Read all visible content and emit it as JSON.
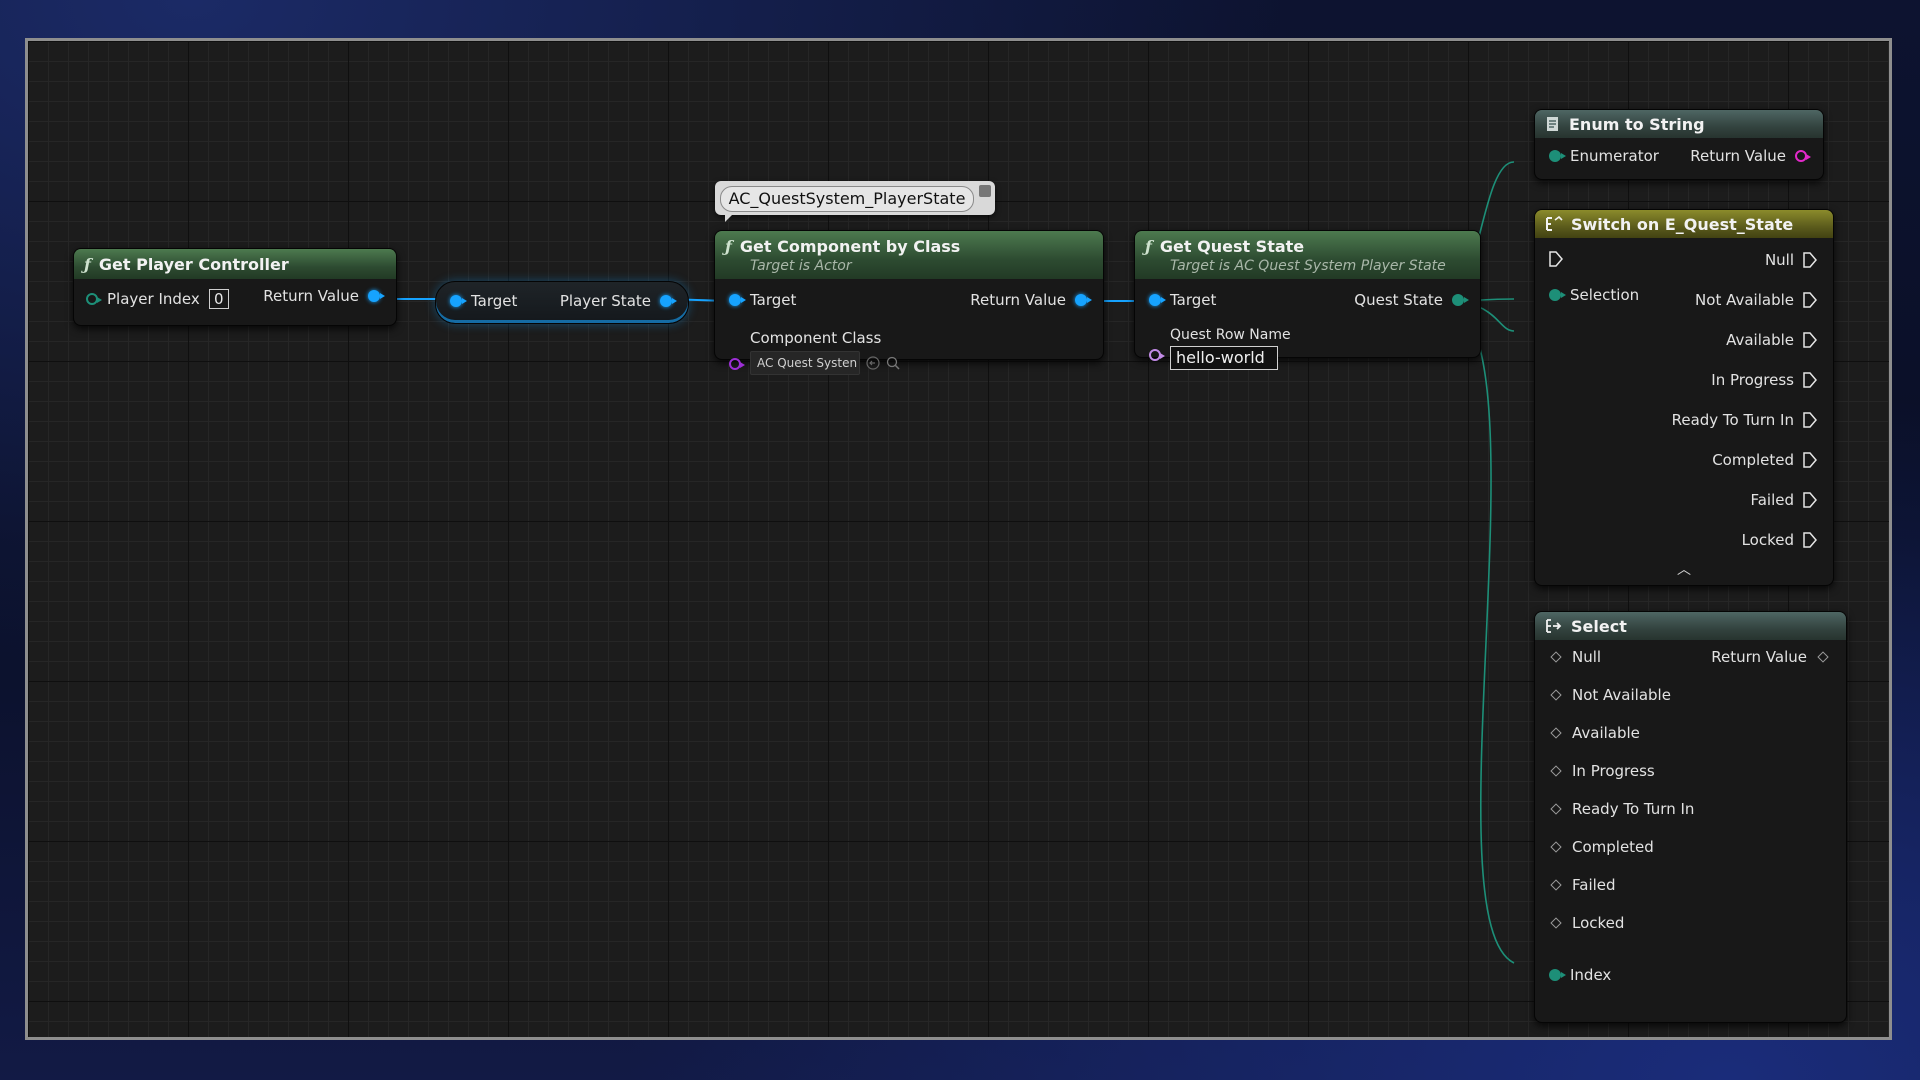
{
  "comment": {
    "text": "AC_QuestSystem_PlayerState"
  },
  "nodes": {
    "get_player_controller": {
      "title": "Get Player Controller",
      "player_index_label": "Player Index",
      "player_index_value": "0",
      "return_value_label": "Return Value"
    },
    "player_state_getter": {
      "target_label": "Target",
      "player_state_label": "Player State"
    },
    "get_component_by_class": {
      "title": "Get Component by Class",
      "subtitle": "Target is Actor",
      "target_label": "Target",
      "return_value_label": "Return Value",
      "component_class_label": "Component Class",
      "component_class_value": "AC Quest Systen"
    },
    "get_quest_state": {
      "title": "Get Quest State",
      "subtitle": "Target is AC Quest System Player State",
      "target_label": "Target",
      "quest_state_label": "Quest State",
      "quest_row_name_label": "Quest Row Name",
      "quest_row_name_value": "hello-world"
    },
    "enum_to_string": {
      "title": "Enum to String",
      "enumerator_label": "Enumerator",
      "return_value_label": "Return Value"
    },
    "switch_on_enum": {
      "title": "Switch on E_Quest_State",
      "selection_label": "Selection",
      "outputs": [
        "Null",
        "Not Available",
        "Available",
        "In Progress",
        "Ready To Turn In",
        "Completed",
        "Failed",
        "Locked"
      ]
    },
    "select": {
      "title": "Select",
      "return_value_label": "Return Value",
      "options": [
        "Null",
        "Not Available",
        "Available",
        "In Progress",
        "Ready To Turn In",
        "Completed",
        "Failed",
        "Locked"
      ],
      "index_label": "Index"
    }
  },
  "colors": {
    "object_pin": "#16a3ff",
    "enum_pin": "#1d8f78",
    "string_pin": "#e229c9",
    "class_pin": "#9d2fd6",
    "name_pin": "#c28be6",
    "function_header": "#3b6140",
    "switch_header": "#6b6b20"
  }
}
